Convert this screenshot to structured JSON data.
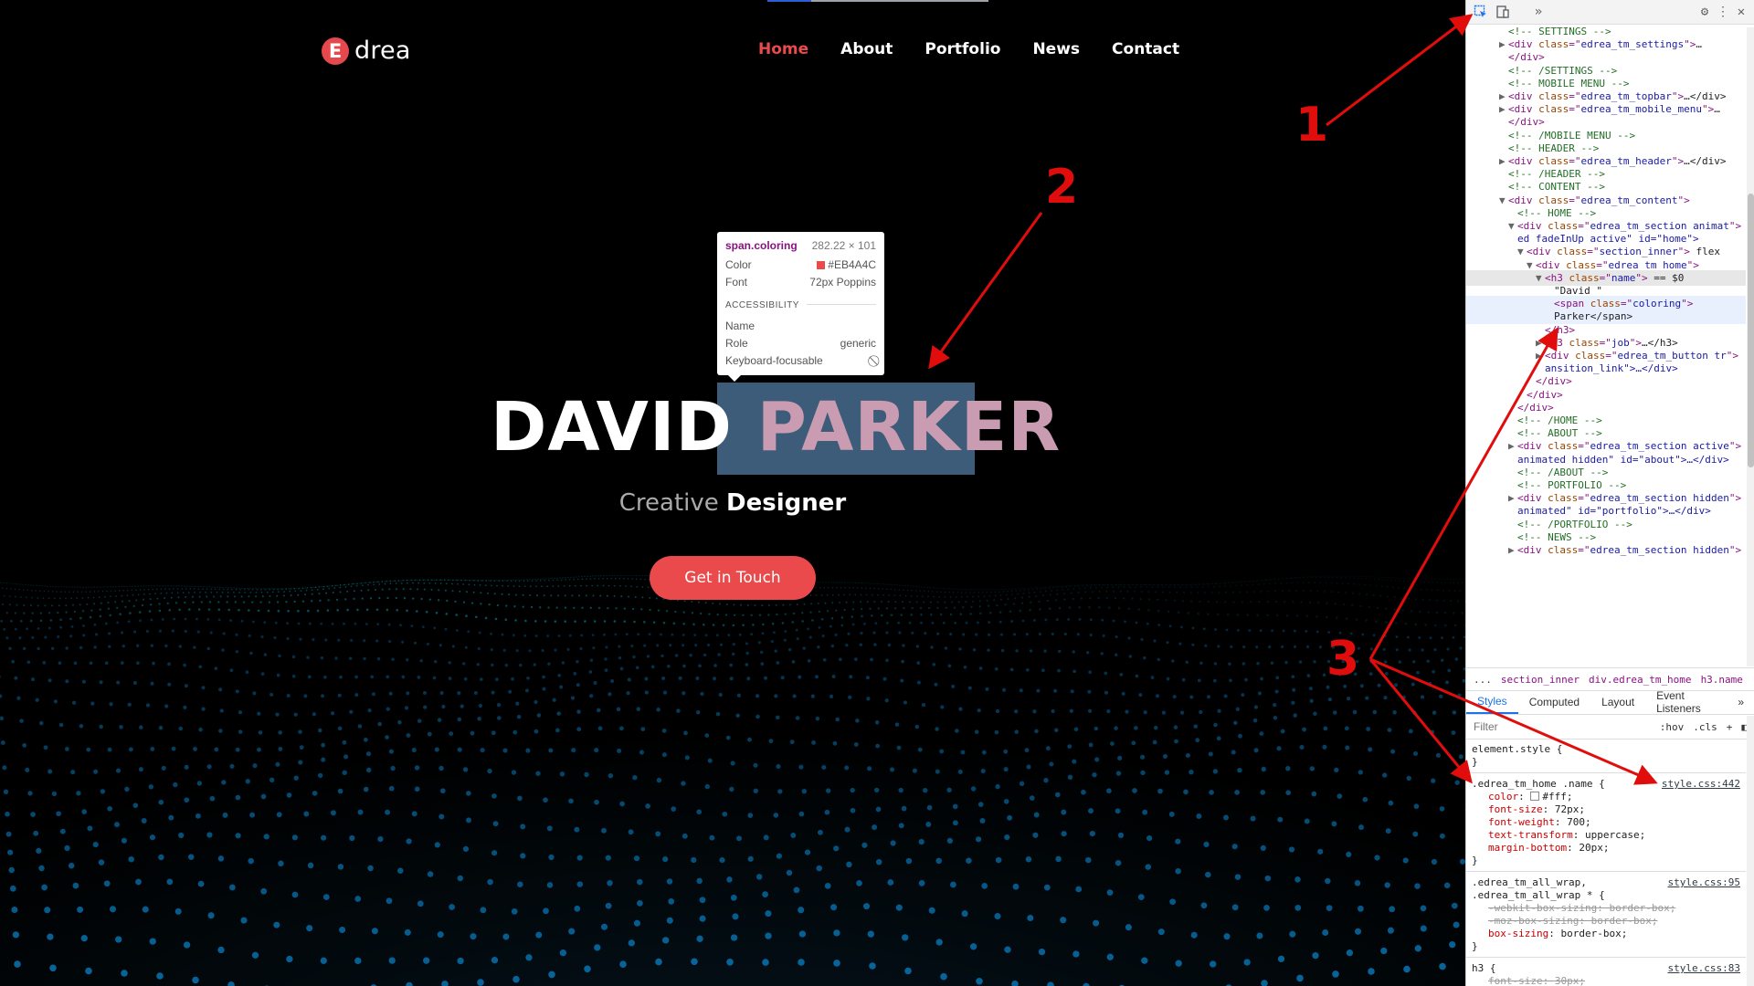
{
  "site": {
    "logo_letter": "E",
    "logo_text": "drea",
    "nav": [
      "Home",
      "About",
      "Portfolio",
      "News",
      "Contact"
    ],
    "nav_active": "Home",
    "name_first": "DAVID",
    "name_last": "PARKER",
    "job_light": "Creative",
    "job_bold": "Designer",
    "cta_label": "Get in Touch",
    "accent_color": "#eb4a4c",
    "loading_progress": 0.2
  },
  "tooltip": {
    "selector": "span.coloring",
    "size": "282.22 × 101",
    "color_label": "Color",
    "color_value": "#EB4A4C",
    "font_label": "Font",
    "font_value": "72px Poppins",
    "section": "ACCESSIBILITY",
    "name_label": "Name",
    "role_label": "Role",
    "role_value": "generic",
    "focus_label": "Keyboard-focusable",
    "focus_icon": "not-allowed-icon"
  },
  "devtools": {
    "elements": [
      {
        "indent": 3,
        "tri": "",
        "kind": "comment",
        "text": "<!-- SETTINGS -->"
      },
      {
        "indent": 3,
        "tri": "▶",
        "kind": "tag",
        "tag": "div",
        "attr": "class",
        "val": "edrea_tm_settings",
        "rest": "…"
      },
      {
        "indent": 3,
        "tri": "",
        "kind": "close",
        "text": "</div>"
      },
      {
        "indent": 3,
        "tri": "",
        "kind": "comment",
        "text": "<!-- /SETTINGS -->"
      },
      {
        "indent": 3,
        "tri": "",
        "kind": "comment",
        "text": "<!-- MOBILE MENU -->"
      },
      {
        "indent": 3,
        "tri": "▶",
        "kind": "tag",
        "tag": "div",
        "attr": "class",
        "val": "edrea_tm_topbar",
        "rest": "…</div>"
      },
      {
        "indent": 3,
        "tri": "▶",
        "kind": "tag",
        "tag": "div",
        "attr": "class",
        "val": "edrea_tm_mobile_menu",
        "rest": "…"
      },
      {
        "indent": 3,
        "tri": "",
        "kind": "close",
        "text": "</div>"
      },
      {
        "indent": 3,
        "tri": "",
        "kind": "comment",
        "text": "<!-- /MOBILE MENU -->"
      },
      {
        "indent": 3,
        "tri": "",
        "kind": "comment",
        "text": "<!-- HEADER -->"
      },
      {
        "indent": 3,
        "tri": "▶",
        "kind": "tag",
        "tag": "div",
        "attr": "class",
        "val": "edrea_tm_header",
        "rest": "…</div>"
      },
      {
        "indent": 3,
        "tri": "",
        "kind": "comment",
        "text": "<!-- /HEADER -->"
      },
      {
        "indent": 3,
        "tri": "",
        "kind": "comment",
        "text": "<!-- CONTENT -->"
      },
      {
        "indent": 3,
        "tri": "▼",
        "kind": "tag",
        "tag": "div",
        "attr": "class",
        "val": "edrea_tm_content",
        "rest": ""
      },
      {
        "indent": 4,
        "tri": "",
        "kind": "comment",
        "text": "<!-- HOME -->"
      },
      {
        "indent": 4,
        "tri": "▼",
        "kind": "tag",
        "tag": "div",
        "attr": "class",
        "val": "edrea_tm_section animat",
        "rest": ""
      },
      {
        "indent": 4,
        "tri": "",
        "kind": "cont",
        "text": "ed fadeInUp active\" id=\"home\">"
      },
      {
        "indent": 5,
        "tri": "▼",
        "kind": "tag",
        "tag": "div",
        "attr": "class",
        "val": "section_inner",
        "rest": " flex"
      },
      {
        "indent": 6,
        "tri": "▼",
        "kind": "tag",
        "tag": "div",
        "attr": "class",
        "val": "edrea_tm_home",
        "rest": ""
      },
      {
        "indent": 7,
        "tri": "▼",
        "kind": "tag",
        "tag": "h3",
        "attr": "class",
        "val": "name",
        "rest": " == $0",
        "hl": true
      },
      {
        "indent": 8,
        "tri": "",
        "kind": "text",
        "text": "\"David \""
      },
      {
        "indent": 8,
        "tri": "",
        "kind": "tag",
        "tag": "span",
        "attr": "class",
        "val": "coloring",
        "rest": "",
        "sel": true
      },
      {
        "indent": 8,
        "tri": "",
        "kind": "text",
        "text": "Parker</span>",
        "sel": true
      },
      {
        "indent": 7,
        "tri": "",
        "kind": "close",
        "text": "</h3>"
      },
      {
        "indent": 7,
        "tri": "▶",
        "kind": "tag",
        "tag": "h3",
        "attr": "class",
        "val": "job",
        "rest": "…</h3>"
      },
      {
        "indent": 7,
        "tri": "▶",
        "kind": "tag",
        "tag": "div",
        "attr": "class",
        "val": "edrea_tm_button tr",
        "rest": ""
      },
      {
        "indent": 7,
        "tri": "",
        "kind": "cont",
        "text": "ansition_link\">…</div>"
      },
      {
        "indent": 6,
        "tri": "",
        "kind": "close",
        "text": "</div>"
      },
      {
        "indent": 5,
        "tri": "",
        "kind": "close",
        "text": "</div>"
      },
      {
        "indent": 4,
        "tri": "",
        "kind": "close",
        "text": "</div>"
      },
      {
        "indent": 4,
        "tri": "",
        "kind": "comment",
        "text": "<!-- /HOME -->"
      },
      {
        "indent": 4,
        "tri": "",
        "kind": "comment",
        "text": "<!-- ABOUT -->"
      },
      {
        "indent": 4,
        "tri": "▶",
        "kind": "tag",
        "tag": "div",
        "attr": "class",
        "val": "edrea_tm_section active",
        "rest": ""
      },
      {
        "indent": 4,
        "tri": "",
        "kind": "cont",
        "text": "animated hidden\" id=\"about\">…</div>"
      },
      {
        "indent": 4,
        "tri": "",
        "kind": "comment",
        "text": "<!-- /ABOUT -->"
      },
      {
        "indent": 4,
        "tri": "",
        "kind": "comment",
        "text": "<!-- PORTFOLIO -->"
      },
      {
        "indent": 4,
        "tri": "▶",
        "kind": "tag",
        "tag": "div",
        "attr": "class",
        "val": "edrea_tm_section hidden",
        "rest": ""
      },
      {
        "indent": 4,
        "tri": "",
        "kind": "cont",
        "text": "animated\" id=\"portfolio\">…</div>"
      },
      {
        "indent": 4,
        "tri": "",
        "kind": "comment",
        "text": "<!-- /PORTFOLIO -->"
      },
      {
        "indent": 4,
        "tri": "",
        "kind": "comment",
        "text": "<!-- NEWS -->"
      },
      {
        "indent": 4,
        "tri": "▶",
        "kind": "tag",
        "tag": "div",
        "attr": "class",
        "val": "edrea_tm_section hidden",
        "rest": ""
      }
    ],
    "breadcrumbs": [
      "...",
      "section_inner",
      "div.edrea_tm_home",
      "h3.name"
    ],
    "tabs": [
      "Styles",
      "Computed",
      "Layout",
      "Event Listeners",
      "»"
    ],
    "filter_placeholder": "Filter",
    "filter_buttons": [
      ":hov",
      ".cls",
      "+"
    ],
    "rules": [
      {
        "selector": "element.style {",
        "src": "",
        "props": [],
        "close": "}"
      },
      {
        "selector": ".edrea_tm_home .name {",
        "src": "style.css:442",
        "props": [
          {
            "name": "color",
            "value": "#fff;",
            "swatch": true,
            "strike": false
          },
          {
            "name": "font-size",
            "value": "72px;",
            "strike": false
          },
          {
            "name": "font-weight",
            "value": "700;",
            "strike": false
          },
          {
            "name": "text-transform",
            "value": "uppercase;",
            "strike": false
          },
          {
            "name": "margin-bottom",
            "value": "20px;",
            "strike": false
          }
        ],
        "close": "}"
      },
      {
        "selector": ".edrea_tm_all_wrap,",
        "selector2": ".edrea_tm_all_wrap * {",
        "src": "style.css:95",
        "props": [
          {
            "name": "-webkit-box-sizing",
            "value": "border-box;",
            "strike": true
          },
          {
            "name": "-moz-box-sizing",
            "value": "border-box;",
            "strike": true
          },
          {
            "name": "box-sizing",
            "value": "border-box;",
            "strike": false
          }
        ],
        "close": "}"
      },
      {
        "selector": "h3 {",
        "src": "style.css:83",
        "props": [
          {
            "name": "font-size",
            "value": "30px;",
            "strike": true
          }
        ],
        "close": ""
      }
    ]
  },
  "annotations": [
    "1",
    "2",
    "3"
  ]
}
